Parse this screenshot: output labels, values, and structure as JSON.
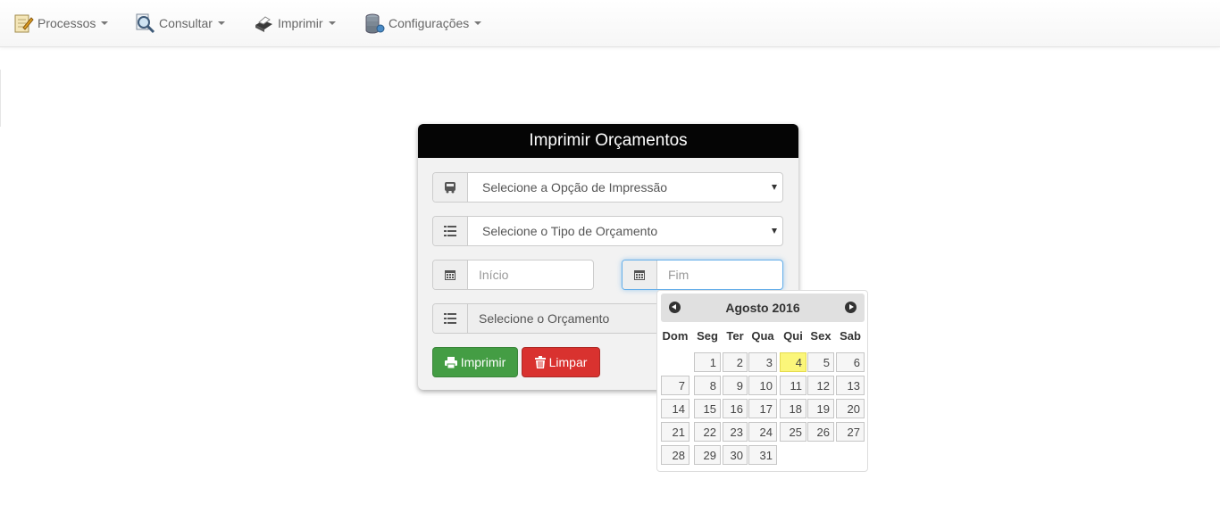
{
  "navbar": {
    "items": [
      {
        "label": "Processos",
        "icon": "notepad-pencil-icon"
      },
      {
        "label": "Consultar",
        "icon": "magnifier-icon"
      },
      {
        "label": "Imprimir",
        "icon": "printer-icon"
      },
      {
        "label": "Configurações",
        "icon": "database-stack-icon"
      }
    ]
  },
  "form": {
    "title": "Imprimir Orçamentos",
    "print_option": "Selecione a Opção de Impressão",
    "budget_type": "Selecione o Tipo de Orçamento",
    "start_placeholder": "Início",
    "end_placeholder": "Fim",
    "budget": "Selecione o Orçamento",
    "print_button": "Imprimir",
    "clear_button": "Limpar"
  },
  "datepicker": {
    "month_label": "Agosto 2016",
    "weekdays": [
      "Dom",
      "Seg",
      "Ter",
      "Qua",
      "Qui",
      "Sex",
      "Sab"
    ],
    "days": [
      "1",
      "2",
      "3",
      "4",
      "5",
      "6",
      "7",
      "8",
      "9",
      "10",
      "11",
      "12",
      "13",
      "14",
      "15",
      "16",
      "17",
      "18",
      "19",
      "20",
      "21",
      "22",
      "23",
      "24",
      "25",
      "26",
      "27",
      "28",
      "29",
      "30",
      "31"
    ],
    "today": "4"
  },
  "colors": {
    "header_bg": "#050505",
    "print_button": "#449d44",
    "clear_button": "#d9322f",
    "today_highlight": "#fbf67a",
    "focus_border": "#66afe9"
  }
}
